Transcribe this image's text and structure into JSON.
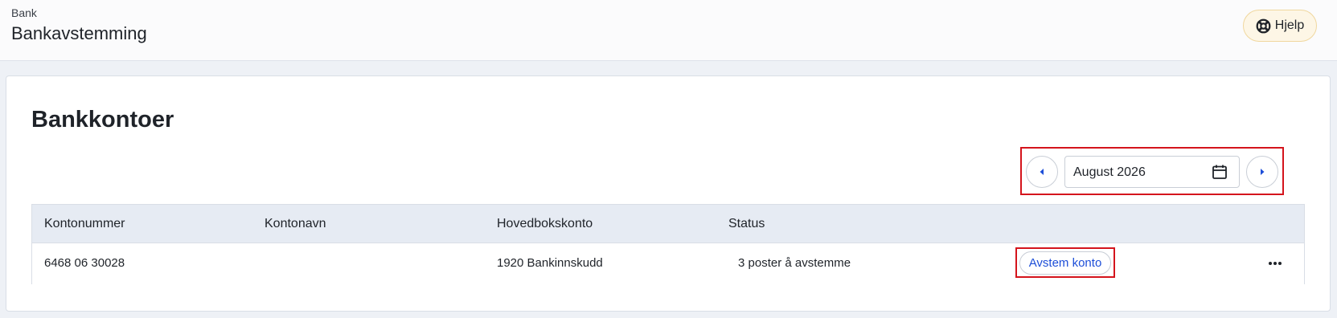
{
  "header": {
    "breadcrumb": "Bank",
    "title": "Bankavstemming",
    "help_label": "Hjelp",
    "help_icon": "lifebuoy-icon"
  },
  "main": {
    "section_title": "Bankkontoer",
    "period": {
      "value": "August 2026",
      "prev_icon": "caret-left-icon",
      "next_icon": "caret-right-icon",
      "calendar_icon": "calendar-icon"
    },
    "table": {
      "columns": [
        "Kontonummer",
        "Kontonavn",
        "Hovedbokskonto",
        "Status"
      ],
      "rows": [
        {
          "kontonummer": "6468 06 30028",
          "kontonavn": "",
          "hovedbokskonto": "1920 Bankinnskudd",
          "status": "3 poster å avstemme",
          "action_label": "Avstem konto",
          "more_icon": "more-horizontal-icon"
        }
      ]
    }
  },
  "colors": {
    "accent": "#1d4ed8",
    "highlight": "#d4141c",
    "help_bg": "#fdf6e6",
    "table_header_bg": "#e6ebf3"
  }
}
